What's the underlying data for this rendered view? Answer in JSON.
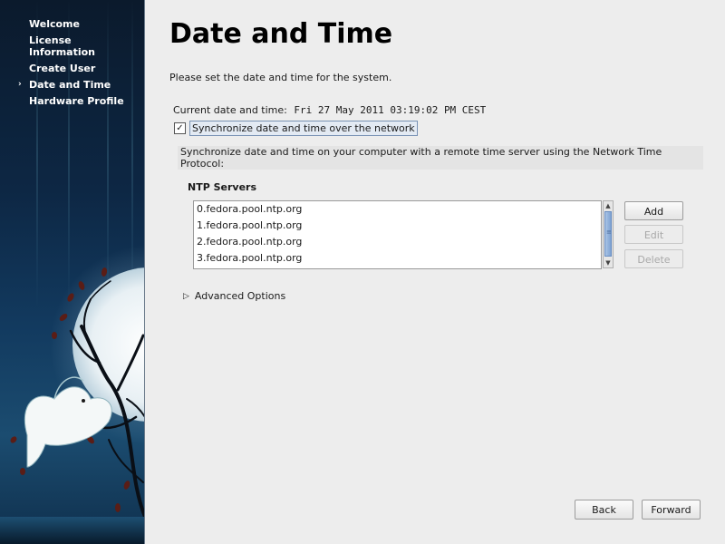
{
  "sidebar": {
    "items": [
      {
        "label": "Welcome",
        "active": false
      },
      {
        "label": "License Information",
        "active": false
      },
      {
        "label": "Create User",
        "active": false
      },
      {
        "label": "Date and Time",
        "active": true
      },
      {
        "label": "Hardware Profile",
        "active": false
      }
    ],
    "active_marker": "›"
  },
  "main": {
    "title": "Date and Time",
    "intro": "Please set the date and time for the system.",
    "current_label": "Current date and time:",
    "current_value": "Fri 27 May 2011 03:19:02 PM CEST",
    "sync": {
      "checked": true,
      "check_glyph": "✓",
      "label": "Synchronize date and time over the network"
    },
    "sync_description": "Synchronize date and time on your computer with a remote time server using the Network Time Protocol:",
    "ntp_heading": "NTP Servers",
    "servers": [
      "0.fedora.pool.ntp.org",
      "1.fedora.pool.ntp.org",
      "2.fedora.pool.ntp.org",
      "3.fedora.pool.ntp.org"
    ],
    "buttons": {
      "add": "Add",
      "edit": "Edit",
      "delete": "Delete"
    },
    "advanced_options": "Advanced Options"
  },
  "nav": {
    "back": "Back",
    "forward": "Forward"
  },
  "icons": {
    "expander": "triangle-right-icon",
    "scroll_up": "chevron-up-icon",
    "scroll_down": "chevron-down-icon"
  },
  "colors": {
    "sidebar_top": "#0b1a2c",
    "sidebar_mid": "#123a5f",
    "selection": "#e3eaf3",
    "scroll_thumb": "#7fa3d3"
  }
}
